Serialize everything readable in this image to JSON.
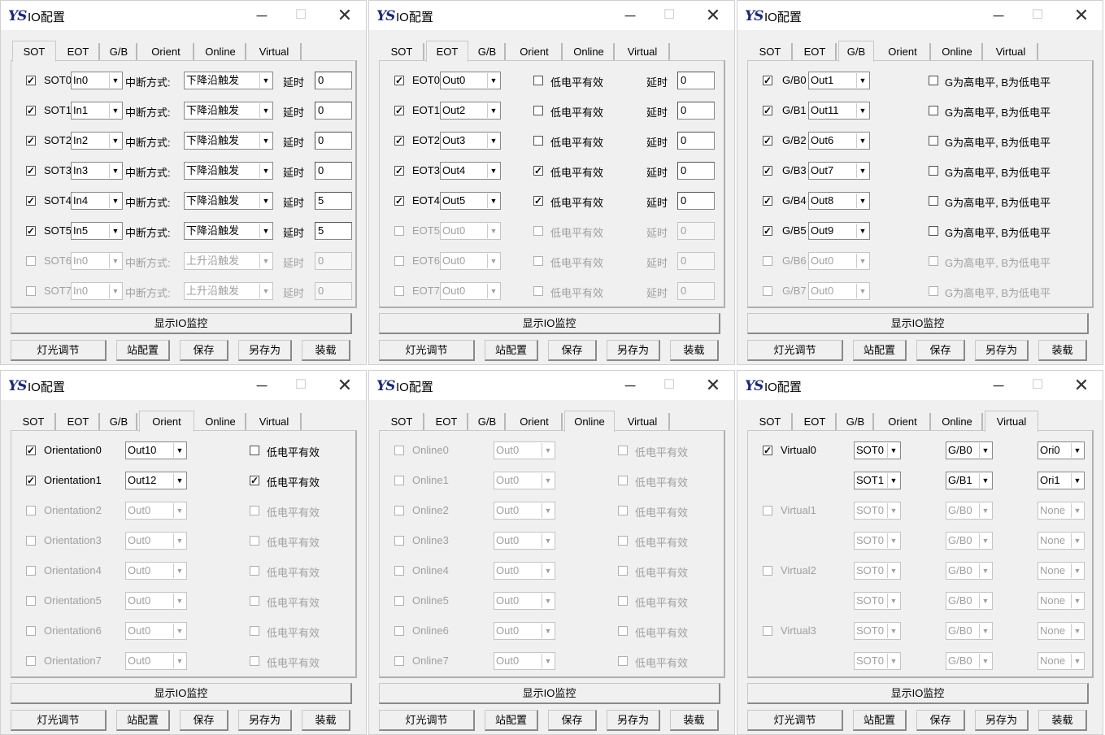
{
  "app": {
    "title": "IO配置",
    "logo": "YS",
    "minimize": "─",
    "maximize": "☐",
    "close": "✕"
  },
  "tabs": [
    "SOT",
    "EOT",
    "G/B",
    "Orient",
    "Online",
    "Virtual"
  ],
  "buttons": {
    "monitor": "显示IO监控",
    "light": "灯光调节",
    "station": "站配置",
    "save": "保存",
    "saveas": "另存为",
    "load": "装载"
  },
  "sot": {
    "mode_label": "中断方式:",
    "delay_label": "延时",
    "rows": [
      {
        "label": "SOT0",
        "checked": true,
        "enabled": true,
        "input": "In0",
        "mode": "下降沿触发",
        "delay": "0"
      },
      {
        "label": "SOT1",
        "checked": true,
        "enabled": true,
        "input": "In1",
        "mode": "下降沿触发",
        "delay": "0"
      },
      {
        "label": "SOT2",
        "checked": true,
        "enabled": true,
        "input": "In2",
        "mode": "下降沿触发",
        "delay": "0"
      },
      {
        "label": "SOT3",
        "checked": true,
        "enabled": true,
        "input": "In3",
        "mode": "下降沿触发",
        "delay": "0"
      },
      {
        "label": "SOT4",
        "checked": true,
        "enabled": true,
        "input": "In4",
        "mode": "下降沿触发",
        "delay": "5"
      },
      {
        "label": "SOT5",
        "checked": true,
        "enabled": true,
        "input": "In5",
        "mode": "下降沿触发",
        "delay": "5"
      },
      {
        "label": "SOT6",
        "checked": false,
        "enabled": false,
        "input": "In0",
        "mode": "上升沿触发",
        "delay": "0"
      },
      {
        "label": "SOT7",
        "checked": false,
        "enabled": false,
        "input": "In0",
        "mode": "上升沿触发",
        "delay": "0"
      }
    ]
  },
  "eot": {
    "low_label": "低电平有效",
    "delay_label": "延时",
    "rows": [
      {
        "label": "EOT0",
        "checked": true,
        "enabled": true,
        "output": "Out0",
        "low": false,
        "delay": "0"
      },
      {
        "label": "EOT1",
        "checked": true,
        "enabled": true,
        "output": "Out2",
        "low": false,
        "delay": "0"
      },
      {
        "label": "EOT2",
        "checked": true,
        "enabled": true,
        "output": "Out3",
        "low": false,
        "delay": "0"
      },
      {
        "label": "EOT3",
        "checked": true,
        "enabled": true,
        "output": "Out4",
        "low": true,
        "delay": "0"
      },
      {
        "label": "EOT4",
        "checked": true,
        "enabled": true,
        "output": "Out5",
        "low": true,
        "delay": "0"
      },
      {
        "label": "EOT5",
        "checked": false,
        "enabled": false,
        "output": "Out0",
        "low": false,
        "delay": "0"
      },
      {
        "label": "EOT6",
        "checked": false,
        "enabled": false,
        "output": "Out0",
        "low": false,
        "delay": "0"
      },
      {
        "label": "EOT7",
        "checked": false,
        "enabled": false,
        "output": "Out0",
        "low": false,
        "delay": "0"
      }
    ]
  },
  "gb": {
    "option_label": "G为高电平, B为低电平",
    "rows": [
      {
        "label": "G/B0",
        "checked": true,
        "enabled": true,
        "output": "Out1",
        "option": false
      },
      {
        "label": "G/B1",
        "checked": true,
        "enabled": true,
        "output": "Out11",
        "option": false
      },
      {
        "label": "G/B2",
        "checked": true,
        "enabled": true,
        "output": "Out6",
        "option": false
      },
      {
        "label": "G/B3",
        "checked": true,
        "enabled": true,
        "output": "Out7",
        "option": false
      },
      {
        "label": "G/B4",
        "checked": true,
        "enabled": true,
        "output": "Out8",
        "option": false
      },
      {
        "label": "G/B5",
        "checked": true,
        "enabled": true,
        "output": "Out9",
        "option": false
      },
      {
        "label": "G/B6",
        "checked": false,
        "enabled": false,
        "output": "Out0",
        "option": false
      },
      {
        "label": "G/B7",
        "checked": false,
        "enabled": false,
        "output": "Out0",
        "option": false
      }
    ]
  },
  "orient": {
    "low_label": "低电平有效",
    "rows": [
      {
        "label": "Orientation0",
        "checked": true,
        "enabled": true,
        "output": "Out10",
        "low": false
      },
      {
        "label": "Orientation1",
        "checked": true,
        "enabled": true,
        "output": "Out12",
        "low": true
      },
      {
        "label": "Orientation2",
        "checked": false,
        "enabled": false,
        "output": "Out0",
        "low": false
      },
      {
        "label": "Orientation3",
        "checked": false,
        "enabled": false,
        "output": "Out0",
        "low": false
      },
      {
        "label": "Orientation4",
        "checked": false,
        "enabled": false,
        "output": "Out0",
        "low": false
      },
      {
        "label": "Orientation5",
        "checked": false,
        "enabled": false,
        "output": "Out0",
        "low": false
      },
      {
        "label": "Orientation6",
        "checked": false,
        "enabled": false,
        "output": "Out0",
        "low": false
      },
      {
        "label": "Orientation7",
        "checked": false,
        "enabled": false,
        "output": "Out0",
        "low": false
      }
    ]
  },
  "online": {
    "low_label": "低电平有效",
    "rows": [
      {
        "label": "Online0",
        "checked": false,
        "enabled": false,
        "output": "Out0",
        "low": false
      },
      {
        "label": "Online1",
        "checked": false,
        "enabled": false,
        "output": "Out0",
        "low": false
      },
      {
        "label": "Online2",
        "checked": false,
        "enabled": false,
        "output": "Out0",
        "low": false
      },
      {
        "label": "Online3",
        "checked": false,
        "enabled": false,
        "output": "Out0",
        "low": false
      },
      {
        "label": "Online4",
        "checked": false,
        "enabled": false,
        "output": "Out0",
        "low": false
      },
      {
        "label": "Online5",
        "checked": false,
        "enabled": false,
        "output": "Out0",
        "low": false
      },
      {
        "label": "Online6",
        "checked": false,
        "enabled": false,
        "output": "Out0",
        "low": false
      },
      {
        "label": "Online7",
        "checked": false,
        "enabled": false,
        "output": "Out0",
        "low": false
      }
    ]
  },
  "virtual": {
    "groups": [
      {
        "label": "Virtual0",
        "checked": true,
        "enabled": true,
        "lines": [
          {
            "sot": "SOT0",
            "gb": "G/B0",
            "ori": "Ori0"
          },
          {
            "sot": "SOT1",
            "gb": "G/B1",
            "ori": "Ori1"
          }
        ]
      },
      {
        "label": "Virtual1",
        "checked": false,
        "enabled": false,
        "lines": [
          {
            "sot": "SOT0",
            "gb": "G/B0",
            "ori": "None"
          },
          {
            "sot": "SOT0",
            "gb": "G/B0",
            "ori": "None"
          }
        ]
      },
      {
        "label": "Virtual2",
        "checked": false,
        "enabled": false,
        "lines": [
          {
            "sot": "SOT0",
            "gb": "G/B0",
            "ori": "None"
          },
          {
            "sot": "SOT0",
            "gb": "G/B0",
            "ori": "None"
          }
        ]
      },
      {
        "label": "Virtual3",
        "checked": false,
        "enabled": false,
        "lines": [
          {
            "sot": "SOT0",
            "gb": "G/B0",
            "ori": "None"
          },
          {
            "sot": "SOT0",
            "gb": "G/B0",
            "ori": "None"
          }
        ]
      }
    ]
  }
}
